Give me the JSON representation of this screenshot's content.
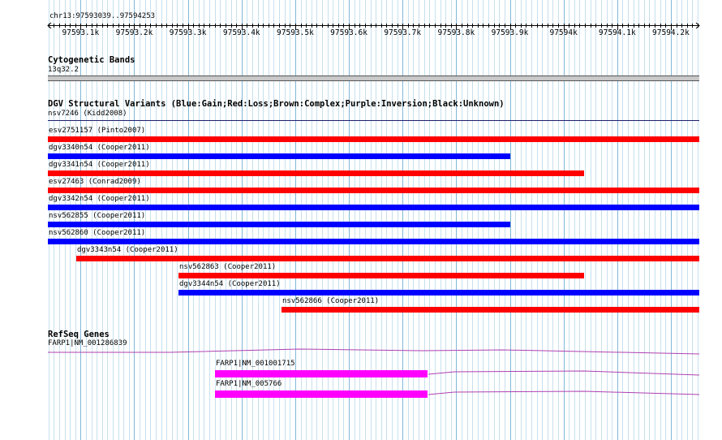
{
  "ruler": {
    "range_label": "chr13:97593039..97594253",
    "ticks": [
      "97593.1k",
      "97593.2k",
      "97593.3k",
      "97593.4k",
      "97593.5k",
      "97593.6k",
      "97593.7k",
      "97593.8k",
      "97593.9k",
      "97594k",
      "97594.1k",
      "97594.2k"
    ]
  },
  "cytoband": {
    "title": "Cytogenetic Bands",
    "band": "13q32.2",
    "color": "#c8c8c8"
  },
  "dgv": {
    "title": "DGV Structural Variants (Blue:Gain;Red:Loss;Brown:Complex;Purple:Inversion;Black:Unknown)",
    "header_item": "nsv7246 (Kidd2008)",
    "colors": {
      "loss": "#ff0000",
      "gain": "#0000ff"
    },
    "variants": [
      {
        "label": "esv2751157 (Pinto2007)",
        "type": "loss",
        "start": 97593039,
        "end": 97594253
      },
      {
        "label": "dgv3340n54 (Cooper2011)",
        "type": "gain",
        "start": 97593039,
        "end": 97593900
      },
      {
        "label": "dgv3341n54 (Cooper2011)",
        "type": "loss",
        "start": 97593039,
        "end": 97594039
      },
      {
        "label": "esv27463 (Conrad2009)",
        "type": "loss",
        "start": 97593039,
        "end": 97594253
      },
      {
        "label": "dgv3342n54 (Cooper2011)",
        "type": "gain",
        "start": 97593039,
        "end": 97594253
      },
      {
        "label": "nsv562855 (Cooper2011)",
        "type": "gain",
        "start": 97593039,
        "end": 97593900
      },
      {
        "label": "nsv562860 (Cooper2011)",
        "type": "gain",
        "start": 97593039,
        "end": 97594253
      },
      {
        "label": "dgv3343n54 (Cooper2011)",
        "type": "loss",
        "start": 97593092,
        "end": 97594253
      },
      {
        "label": "nsv562863 (Cooper2011)",
        "type": "loss",
        "start": 97593282,
        "end": 97594039
      },
      {
        "label": "dgv3344n54 (Cooper2011)",
        "type": "gain",
        "start": 97593282,
        "end": 97594253
      },
      {
        "label": "nsv562866 (Cooper2011)",
        "type": "loss",
        "start": 97593475,
        "end": 97594253
      }
    ]
  },
  "refseq": {
    "title": "RefSeq Genes",
    "color": "#ff00ff",
    "intron_color": "#b040b0",
    "genes": [
      {
        "label": "FARP1|NM_001286839"
      },
      {
        "label": "FARP1|NM_001001715",
        "exon_start": 97593351,
        "exon_end": 97593746
      },
      {
        "label": "FARP1|NM_005766",
        "exon_start": 97593351,
        "exon_end": 97593746
      }
    ]
  }
}
